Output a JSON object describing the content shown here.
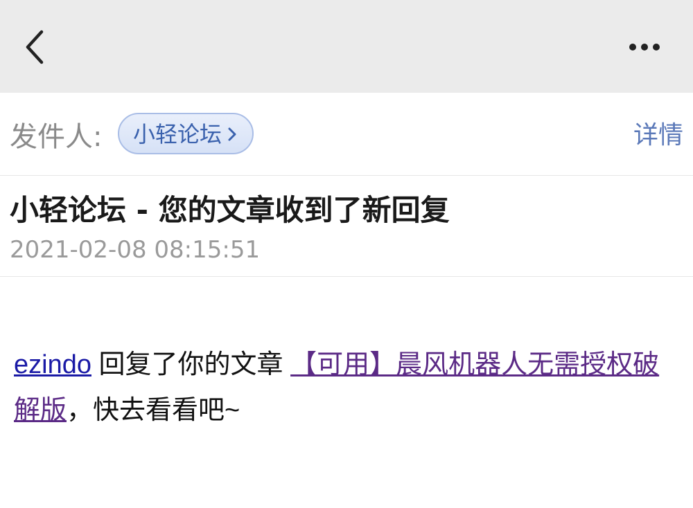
{
  "topbar": {
    "back_icon": "chevron-left-icon",
    "more_icon": "more-horizontal-icon"
  },
  "sender": {
    "label": "发件人:",
    "name": "小轻论坛",
    "chip_arrow_icon": "chevron-right-icon",
    "details_label": "详情"
  },
  "message": {
    "subject": "小轻论坛 - 您的文章收到了新回复",
    "timestamp": "2021-02-08 08:15:51"
  },
  "body": {
    "user": "ezindo",
    "text_replied": " 回复了你的文章 ",
    "article_title": "【可用】晨风机器人无需授权破解版",
    "text_end": "，快去看看吧~"
  },
  "colors": {
    "topbar_bg": "#ebebeb",
    "chip_text": "#3a61ad",
    "details_link": "#5a78b8",
    "user_link": "#1a1aa6",
    "article_link": "#5b2a86"
  }
}
